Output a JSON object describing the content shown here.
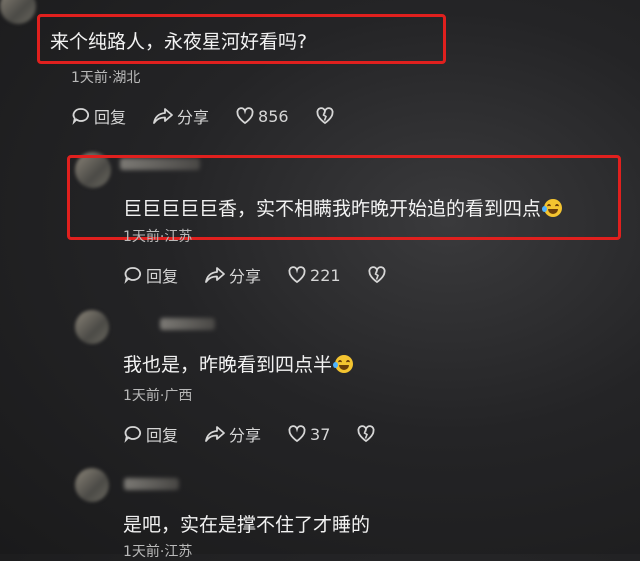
{
  "comments": [
    {
      "text": "来个纯路人，永夜星河好看吗?",
      "meta": "1天前·湖北",
      "reply_label": "回复",
      "share_label": "分享",
      "likes": "856"
    },
    {
      "text": "巨巨巨巨巨香，实不相瞒我昨晚开始追的看到四点",
      "emoji": "laughing-tears-emoji",
      "meta": "1天前·江苏",
      "reply_label": "回复",
      "share_label": "分享",
      "likes": "221"
    },
    {
      "text": "我也是，昨晚看到四点半",
      "emoji": "laughing-tears-emoji",
      "meta": "1天前·广西",
      "reply_label": "回复",
      "share_label": "分享",
      "likes": "37"
    },
    {
      "text": "是吧，实在是撑不住了才睡的",
      "meta": "1天前·江苏"
    }
  ],
  "colors": {
    "highlight_box": "#e0201e",
    "background": "#242426"
  }
}
